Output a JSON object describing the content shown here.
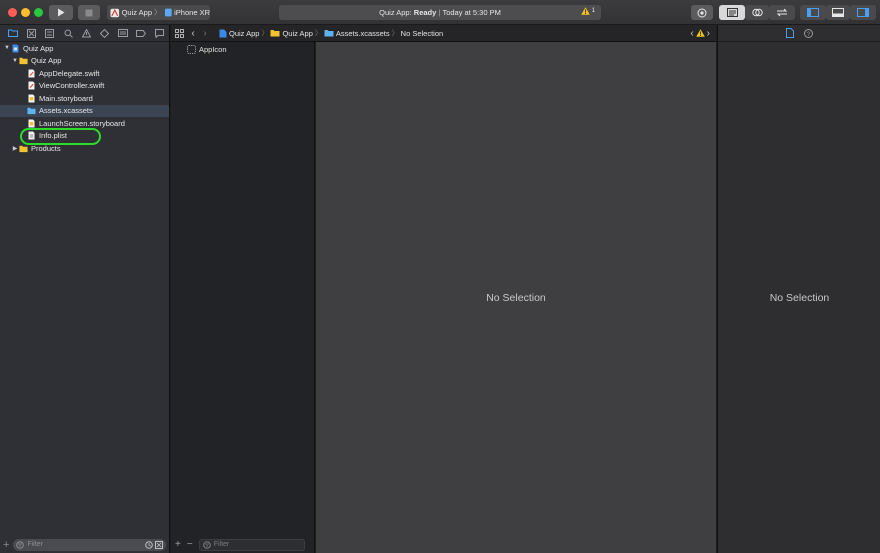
{
  "toolbar": {
    "scheme_target": "Quiz App",
    "scheme_device": "iPhone XR",
    "activity_project": "Quiz App:",
    "activity_status": "Ready",
    "activity_divider": "|",
    "activity_time": "Today at 5:30 PM",
    "warning_count": "1"
  },
  "navigator": {
    "tabs": [
      "folder-icon",
      "source-control-icon",
      "symbol-icon",
      "find-icon",
      "issue-icon",
      "test-icon",
      "debug-icon",
      "breakpoint-icon",
      "report-icon"
    ],
    "tree": {
      "project": "Quiz App",
      "group": "Quiz App",
      "files": [
        "AppDelegate.swift",
        "ViewController.swift",
        "Main.storyboard",
        "Assets.xcassets",
        "LaunchScreen.storyboard",
        "Info.plist"
      ],
      "products": "Products"
    },
    "selected_file": "Assets.xcassets",
    "filter_placeholder": "Filter"
  },
  "jumpbar": {
    "crumbs": [
      "Quiz App",
      "Quiz App",
      "Assets.xcassets",
      "No Selection"
    ]
  },
  "assets": {
    "items": [
      "AppIcon"
    ],
    "filter_placeholder": "Filter"
  },
  "editor": {
    "empty_text": "No Selection"
  },
  "inspector": {
    "empty_text": "No Selection"
  },
  "colors": {
    "accent_blue": "#4a9ff5",
    "folder_yellow": "#f2c230",
    "highlight_green": "#2bdc2b",
    "warning_yellow": "#f5c518"
  }
}
